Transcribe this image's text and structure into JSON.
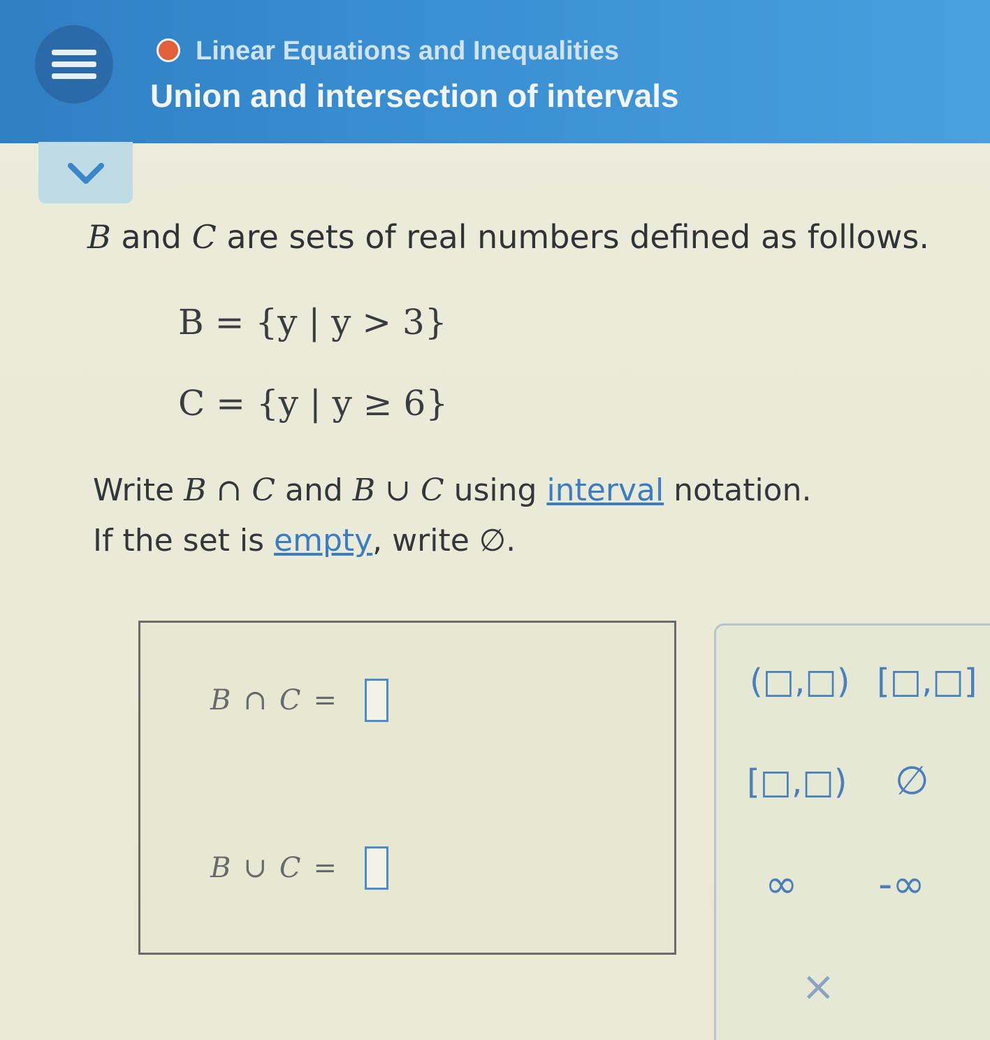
{
  "header": {
    "topic": "Linear Equations and Inequalities",
    "lesson": "Union and intersection of intervals"
  },
  "problem": {
    "intro_b": "B",
    "intro_and": " and ",
    "intro_c": "C",
    "intro_rest": " are sets of real numbers defined as follows.",
    "set_b": "B = {y | y > 3}",
    "set_c": "C = {y | y ≥ 6}",
    "instr1_pre": "Write ",
    "instr1_expr1": "B ∩ C",
    "instr1_and": " and ",
    "instr1_expr2": "B ∪ C",
    "instr1_using": " using ",
    "instr1_link": "interval",
    "instr1_post": " notation.",
    "instr2_pre": "If the set is ",
    "instr2_link": "empty",
    "instr2_post": ", write ∅."
  },
  "answers": {
    "intersection_label_b": "B",
    "intersection_op": "∩",
    "intersection_label_c": "C",
    "union_label_b": "B",
    "union_op": "∪",
    "union_label_c": "C",
    "equals": "=",
    "intersection_value": "",
    "union_value": ""
  },
  "keypad": {
    "open_open": "(□,□)",
    "closed_closed": "[□,□]",
    "closed_open": "[□,□)",
    "empty_set": "∅",
    "infinity": "∞",
    "neg_infinity": "-∞",
    "clear": "×"
  },
  "colors": {
    "header": "#3a8fd2",
    "status_dot": "#e0603a",
    "link": "#3b7cc4",
    "input_border": "#4d8bd0"
  }
}
